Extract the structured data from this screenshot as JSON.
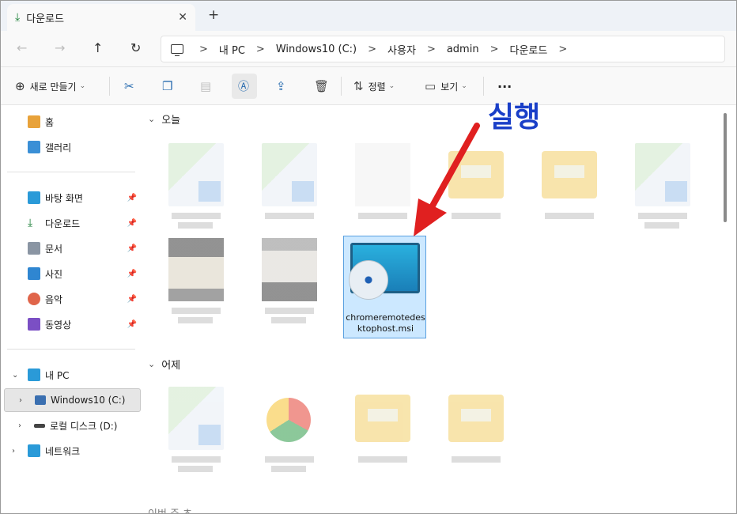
{
  "tab": {
    "title": "다운로드",
    "close_glyph": "✕",
    "new_tab_glyph": "+"
  },
  "nav": {
    "back": "←",
    "forward": "→",
    "up": "↑",
    "refresh": "↻"
  },
  "breadcrumb": {
    "items": [
      "내 PC",
      "Windows10 (C:)",
      "사용자",
      "admin",
      "다운로드"
    ],
    "sep": ">"
  },
  "toolbar": {
    "new_label": "새로 만들기",
    "sort_label": "정렬",
    "view_label": "보기",
    "more_label": "···"
  },
  "sidebar": {
    "home": "홈",
    "gallery": "갤러리",
    "quick": [
      "바탕 화면",
      "다운로드",
      "문서",
      "사진",
      "음악",
      "동영상"
    ],
    "this_pc": "내 PC",
    "drive_c": "Windows10 (C:)",
    "drive_d": "로컬 디스크 (D:)",
    "network": "네트워크"
  },
  "groups": {
    "today": "오늘",
    "yesterday": "어제",
    "earlier": "이번 주 초"
  },
  "selected_file": {
    "name": "chromeremotedesktophost.msi"
  },
  "annotation": {
    "text": "실행",
    "color": "#1a3fc8",
    "arrow_color": "#e02020"
  }
}
